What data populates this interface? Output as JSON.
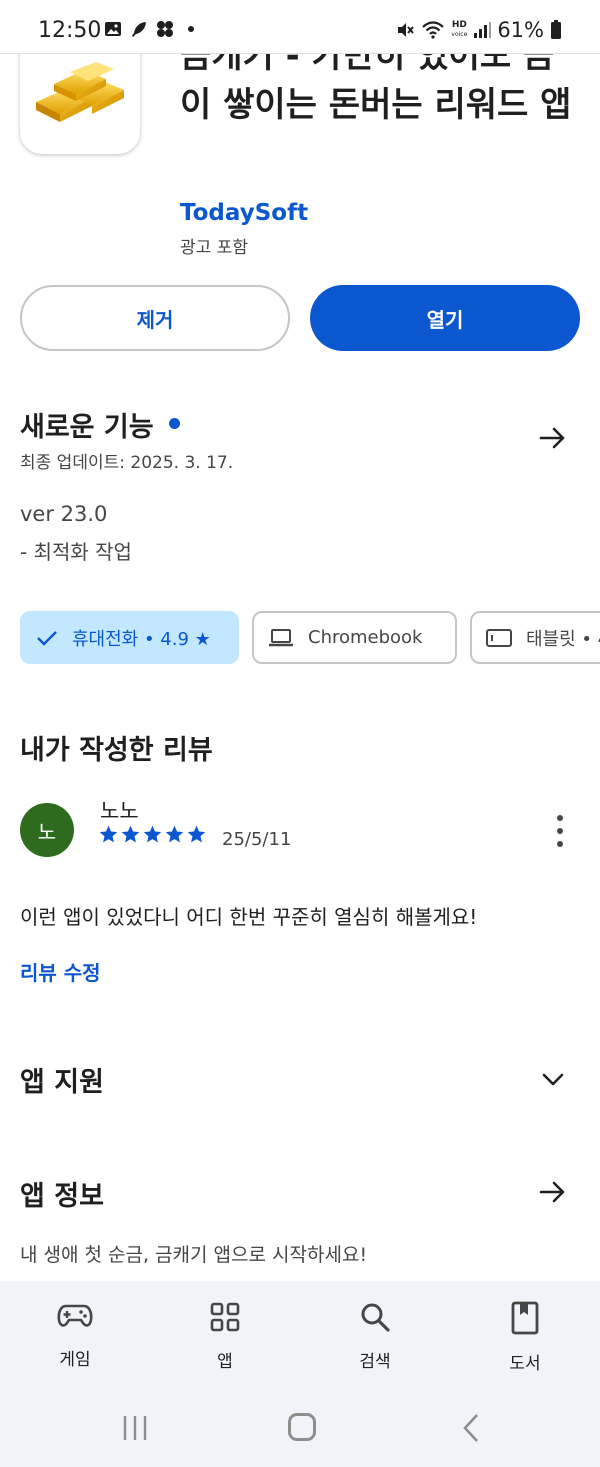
{
  "status_bar": {
    "time": "12:50",
    "battery": "61%",
    "hd_label": "HD",
    "hd_sub": "voice",
    "icons": [
      "gallery-icon",
      "feather-icon",
      "clover-icon",
      "dot-icon",
      "mute-icon",
      "wifi-icon",
      "signal-icon",
      "battery-icon"
    ]
  },
  "app": {
    "title": "금캐기 - 가만히 있어도 금이 쌓이는 돈버는 리워드 앱",
    "developer": "TodaySoft",
    "ads_label": "광고 포함",
    "icon": "gold-bars-icon"
  },
  "actions": {
    "remove_label": "제거",
    "open_label": "열기"
  },
  "whats_new": {
    "title": "새로운 기능",
    "updated": "최종 업데이트: 2025. 3. 17.",
    "version": "ver 23.0",
    "note": "- 최적화 작업"
  },
  "device_chips": [
    {
      "label": "휴대전화 • 4.9 ★",
      "selected": true,
      "icon": "check-icon"
    },
    {
      "label": "Chromebook",
      "selected": false,
      "icon": "laptop-icon"
    },
    {
      "label": "태블릿 • 4",
      "selected": false,
      "icon": "tablet-icon"
    }
  ],
  "my_review": {
    "title": "내가 작성한 리뷰",
    "avatar_letter": "노",
    "author": "노노",
    "stars": 5,
    "date": "25/5/11",
    "text": "이런 앱이 있었다니 어디 한번 꾸준히 열심히 해볼게요!",
    "edit_label": "리뷰 수정"
  },
  "sections": {
    "support_title": "앱 지원",
    "info_title": "앱 정보",
    "info_desc": "내 생애 첫 순금, 금캐기 앱으로 시작하세요!"
  },
  "bottom_nav": [
    {
      "label": "게임",
      "icon": "gamepad-icon"
    },
    {
      "label": "앱",
      "icon": "apps-grid-icon"
    },
    {
      "label": "검색",
      "icon": "search-icon"
    },
    {
      "label": "도서",
      "icon": "book-icon"
    }
  ],
  "colors": {
    "accent": "#0b57d0",
    "chip_selected_bg": "#c2e7ff",
    "avatar_bg": "#2e6b1f",
    "nav_bg": "#f0f4f9"
  }
}
